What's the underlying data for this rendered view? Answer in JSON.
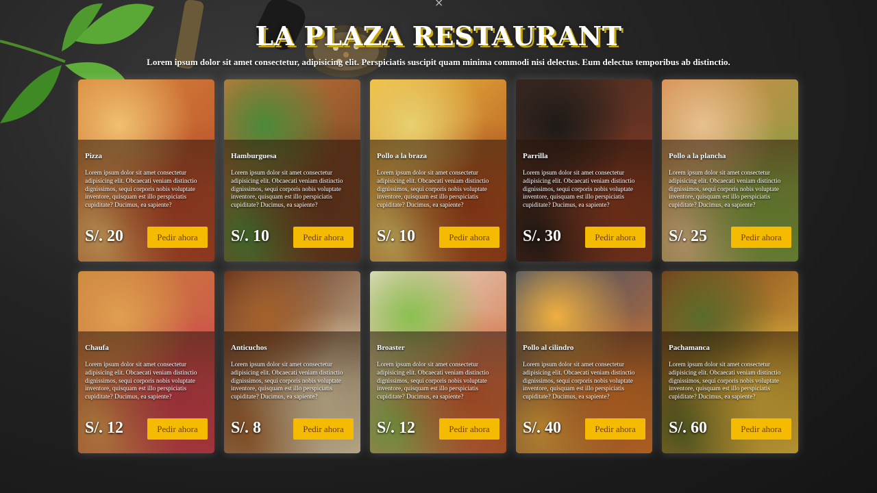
{
  "header": {
    "close_glyph": "×",
    "title": "LA PLAZA RESTAURANT",
    "subtitle": "Lorem ipsum dolor sit amet consectetur, adipisicing elit. Perspiciatis suscipit quam minima commodi nisi delectus. Eum delectus temporibus ab distinctio."
  },
  "colors": {
    "accent": "#f5bb00",
    "button_text": "#6b3a10",
    "background": "#232323"
  },
  "menu": {
    "items": [
      {
        "name": "Pizza",
        "price": "S/. 20",
        "button": "Pedir ahora",
        "description": "Lorem ipsum dolor sit amet consectetur adipisicing elit. Obcaecati veniam distinctio dignissimos, sequi corporis nobis voluptate inventore, quisquam est illo perspiciatis cupiditate? Ducimus, ea sapiente?",
        "image_icon": "pizza-image",
        "palette": [
          "#d98a3a",
          "#b5462a",
          "#f0c070"
        ]
      },
      {
        "name": "Hamburguesa",
        "price": "S/. 10",
        "button": "Pedir ahora",
        "description": "Lorem ipsum dolor sit amet consectetur adipisicing elit. Obcaecati veniam distinctio dignissimos, sequi corporis nobis voluptate inventore, quisquam est illo perspiciatis cupiditate? Ducimus, ea sapiente?",
        "image_icon": "burger-image",
        "palette": [
          "#c77a3a",
          "#6b3a1f",
          "#4a8a3a"
        ]
      },
      {
        "name": "Pollo a la braza",
        "price": "S/. 10",
        "button": "Pedir ahora",
        "description": "Lorem ipsum dolor sit amet consectetur adipisicing elit. Obcaecati veniam distinctio dignissimos, sequi corporis nobis voluptate inventore, quisquam est illo perspiciatis cupiditate? Ducimus, ea sapiente?",
        "image_icon": "roast-chicken-image",
        "palette": [
          "#f2c040",
          "#a5441c",
          "#e8d070"
        ]
      },
      {
        "name": "Parrilla",
        "price": "S/. 30",
        "button": "Pedir ahora",
        "description": "Lorem ipsum dolor sit amet consectetur adipisicing elit. Obcaecati veniam distinctio dignissimos, sequi corporis nobis voluptate inventore, quisquam est illo perspiciatis cupiditate? Ducimus, ea sapiente?",
        "image_icon": "grill-image",
        "palette": [
          "#3a2a22",
          "#8a3a22",
          "#1e1a18"
        ]
      },
      {
        "name": "Pollo a la plancha",
        "price": "S/. 25",
        "button": "Pedir ahora",
        "description": "Lorem ipsum dolor sit amet consectetur adipisicing elit. Obcaecati veniam distinctio dignissimos, sequi corporis nobis voluptate inventore, quisquam est illo perspiciatis cupiditate? Ducimus, ea sapiente?",
        "image_icon": "grilled-chicken-image",
        "palette": [
          "#d98a4a",
          "#7aa040",
          "#e8c090"
        ]
      },
      {
        "name": "Chaufa",
        "price": "S/. 12",
        "button": "Pedir ahora",
        "description": "Lorem ipsum dolor sit amet consectetur adipisicing elit. Obcaecati veniam distinctio dignissimos, sequi corporis nobis voluptate inventore, quisquam est illo perspiciatis cupiditate? Ducimus, ea sapiente?",
        "image_icon": "fried-rice-image",
        "palette": [
          "#c8883a",
          "#d04050",
          "#e0a050"
        ]
      },
      {
        "name": "Anticuchos",
        "price": "S/. 8",
        "button": "Pedir ahora",
        "description": "Lorem ipsum dolor sit amet consectetur adipisicing elit. Obcaecati veniam distinctio dignissimos, sequi corporis nobis voluptate inventore, quisquam est illo perspiciatis cupiditate? Ducimus, ea sapiente?",
        "image_icon": "skewers-image",
        "palette": [
          "#5a2a1a",
          "#e8d8b0",
          "#a5602a"
        ]
      },
      {
        "name": "Broaster",
        "price": "S/. 12",
        "button": "Pedir ahora",
        "description": "Lorem ipsum dolor sit amet consectetur adipisicing elit. Obcaecati veniam distinctio dignissimos, sequi corporis nobis voluptate inventore, quisquam est illo perspiciatis cupiditate? Ducimus, ea sapiente?",
        "image_icon": "fried-chicken-image",
        "palette": [
          "#e8e0d0",
          "#d06030",
          "#8ac050"
        ]
      },
      {
        "name": "Pollo al cilindro",
        "price": "S/. 40",
        "button": "Pedir ahora",
        "description": "Lorem ipsum dolor sit amet consectetur adipisicing elit. Obcaecati veniam distinctio dignissimos, sequi corporis nobis voluptate inventore, quisquam est illo perspiciatis cupiditate? Ducimus, ea sapiente?",
        "image_icon": "barrel-chicken-image",
        "palette": [
          "#3a4a6a",
          "#e07a2a",
          "#f0b040"
        ]
      },
      {
        "name": "Pachamanca",
        "price": "S/. 60",
        "button": "Pedir ahora",
        "description": "Lorem ipsum dolor sit amet consectetur adipisicing elit. Obcaecati veniam distinctio dignissimos, sequi corporis nobis voluptate inventore, quisquam est illo perspiciatis cupiditate? Ducimus, ea sapiente?",
        "image_icon": "pachamanca-image",
        "palette": [
          "#7a3a1a",
          "#e8c040",
          "#5a6a2a"
        ]
      }
    ]
  }
}
